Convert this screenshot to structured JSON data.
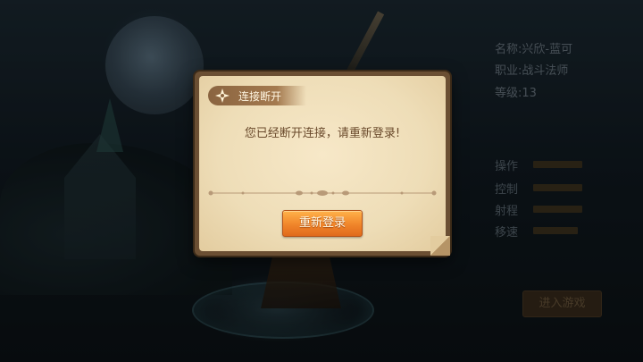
{
  "hero_info": {
    "name_label": "名称:",
    "name_value": "兴欣-蓝可",
    "class_label": "职业:",
    "class_value": "战斗法师",
    "level_label": "等级:",
    "level_value": "13"
  },
  "stats": [
    {
      "label": "操作",
      "level": 0.55
    },
    {
      "label": "控制",
      "level": 0.55
    },
    {
      "label": "射程",
      "level": 0.55
    },
    {
      "label": "移速",
      "level": 0.5
    }
  ],
  "enter_button": "进入游戏",
  "dialog": {
    "title": "连接断开",
    "message": "您已经断开连接，请重新登录!",
    "button": "重新登录"
  },
  "colors": {
    "accent_orange": "#f0852a",
    "paper": "#f2e3c0",
    "frame": "#6b4f33"
  }
}
